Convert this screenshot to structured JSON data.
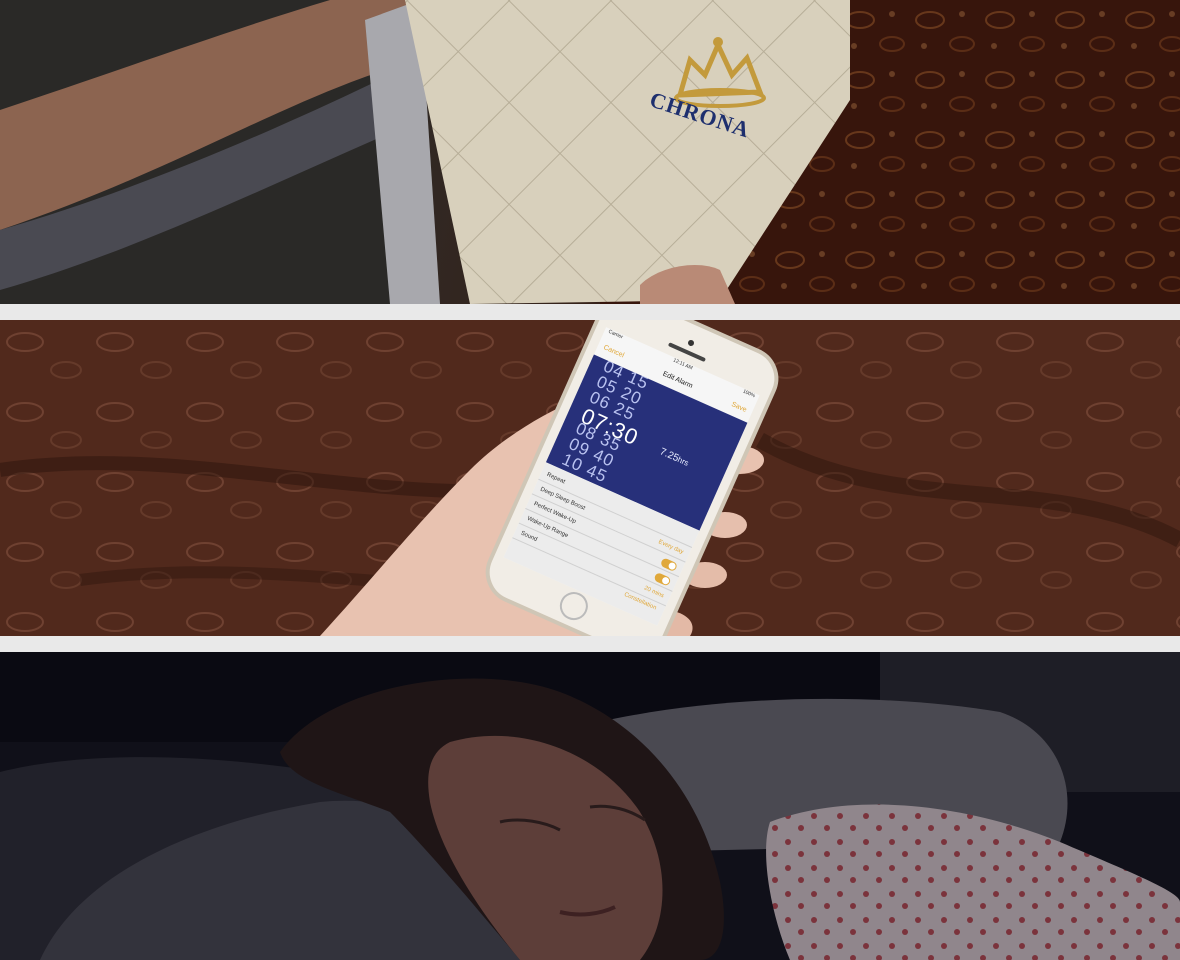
{
  "pillow": {
    "logo_text": "CHRONA"
  },
  "phone": {
    "status_time": "12:11 AM",
    "carrier": "Carrier",
    "battery": "100%",
    "nav": {
      "cancel": "Cancel",
      "title": "Edit Alarm",
      "save": "Save"
    },
    "picker": {
      "rows": [
        {
          "h": "04",
          "m": "15"
        },
        {
          "h": "05",
          "m": "20"
        },
        {
          "h": "06",
          "m": "25"
        },
        {
          "h": "07",
          "m": "30"
        },
        {
          "h": "08",
          "m": "35"
        },
        {
          "h": "09",
          "m": "40"
        },
        {
          "h": "10",
          "m": "45"
        }
      ],
      "duration": "7.25",
      "duration_unit": "hrs"
    },
    "settings": [
      {
        "label": "Repeat",
        "value": ""
      },
      {
        "label": "Deep Sleep Boost",
        "value": "Every day"
      },
      {
        "label": "Perfect Wake-Up",
        "value": ""
      },
      {
        "label": "Wake-Up Range",
        "value": ""
      },
      {
        "label": "Sound",
        "value": "20 mins"
      }
    ],
    "sound_value": "Constellation",
    "colors": {
      "accent": "#e0a83a",
      "screen": "#27307a"
    }
  }
}
